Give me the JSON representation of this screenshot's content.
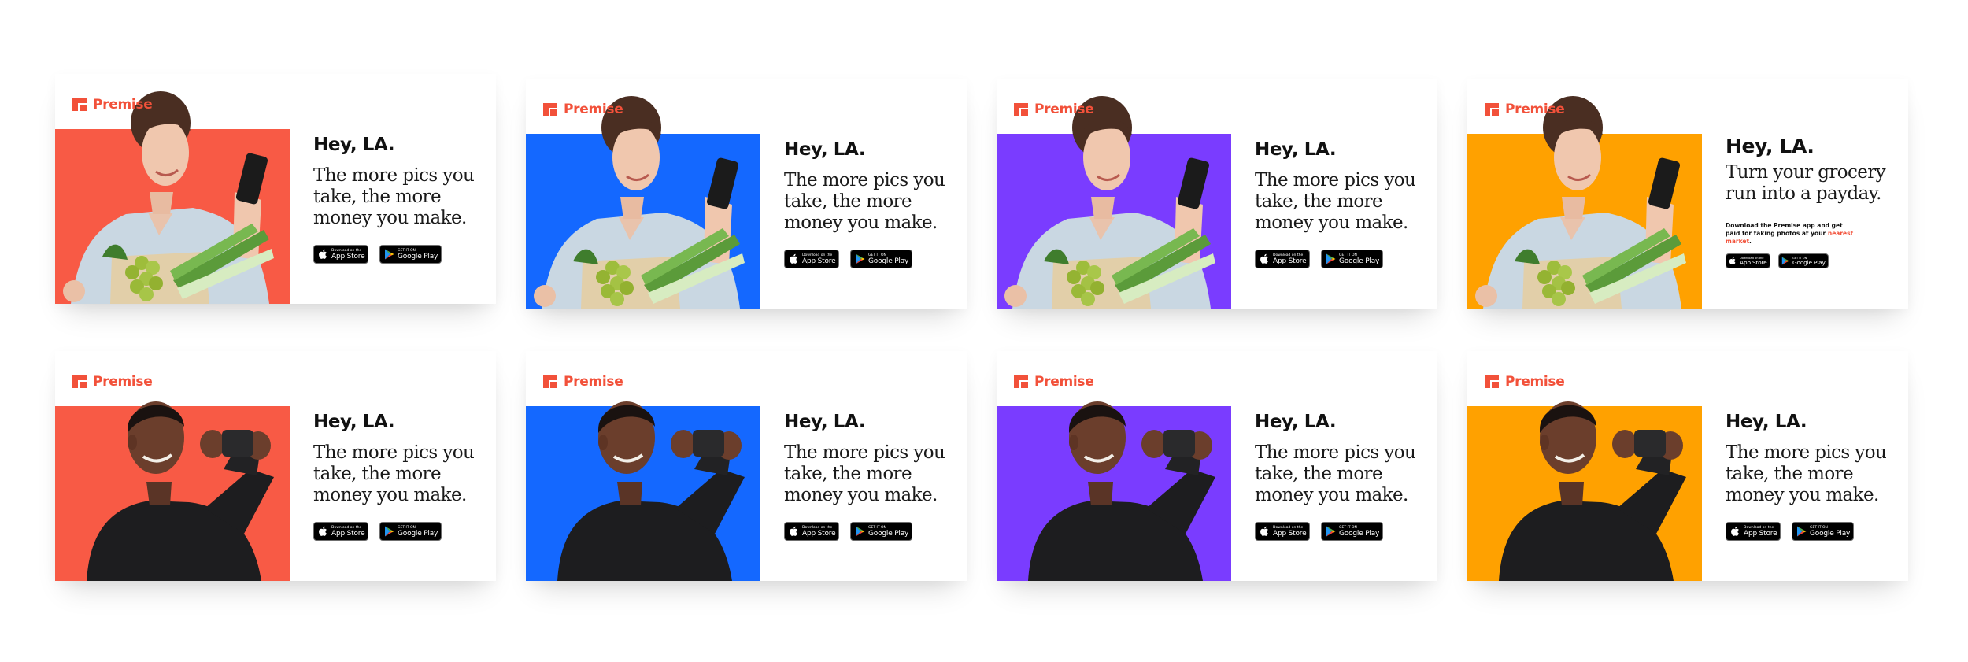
{
  "brand": {
    "name": "Premise",
    "color": "#f2513a"
  },
  "store_badges": {
    "apple_small": "Download on the",
    "apple_big": "App Store",
    "google_small": "GET IT ON",
    "google_big": "Google Play"
  },
  "ads": [
    {
      "headline": "Hey, LA.",
      "body": "The more pics you take, the more money you make.",
      "bg": "#f85a45",
      "model": "woman"
    },
    {
      "headline": "Hey, LA.",
      "body": "The more pics you take, the more money you make.",
      "bg": "#1468ff",
      "model": "woman"
    },
    {
      "headline": "Hey, LA.",
      "body": "The more pics you take, the more money you make.",
      "bg": "#7a3cff",
      "model": "woman"
    },
    {
      "headline": "Hey, LA.",
      "body": "Turn your grocery run into a payday.",
      "bg": "#ffa100",
      "model": "woman",
      "fine_print_pre": "Download the Premise app and get paid for taking photos at your ",
      "fine_print_highlight": "nearest market",
      "fine_print_post": "."
    },
    {
      "headline": "Hey, LA.",
      "body": "The more pics you take, the more money you make.",
      "bg": "#f85a45",
      "model": "man"
    },
    {
      "headline": "Hey, LA.",
      "body": "The more pics you take, the more money you make.",
      "bg": "#1468ff",
      "model": "man"
    },
    {
      "headline": "Hey, LA.",
      "body": "The more pics you take, the more money you make.",
      "bg": "#7a3cff",
      "model": "man"
    },
    {
      "headline": "Hey, LA.",
      "body": "The more pics you take, the more money you make.",
      "bg": "#ffa100",
      "model": "man"
    }
  ]
}
